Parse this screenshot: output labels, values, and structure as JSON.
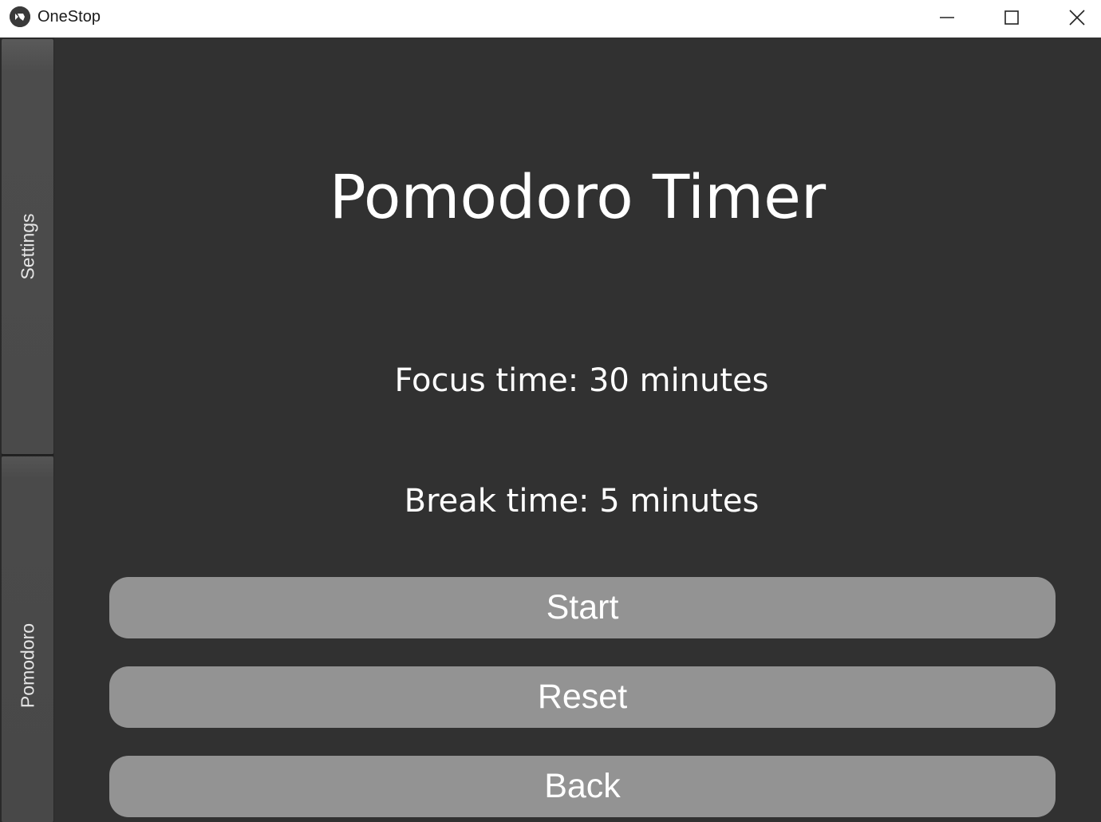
{
  "window": {
    "title": "OneStop"
  },
  "icons": {
    "app": "kivy-logo-icon",
    "minimize": "minimize-icon",
    "maximize": "maximize-icon",
    "close": "close-icon"
  },
  "sidebar": {
    "tabs": [
      {
        "label": "Settings"
      },
      {
        "label": "Pomodoro"
      }
    ]
  },
  "main": {
    "title": "Pomodoro Timer",
    "focus_text": "Focus time: 30 minutes",
    "break_text": "Break time: 5 minutes",
    "buttons": {
      "start": "Start",
      "reset": "Reset",
      "back": "Back"
    }
  },
  "colors": {
    "background": "#313131",
    "button": "#939393",
    "tab": "#4a4a4a",
    "text": "#ffffff"
  }
}
